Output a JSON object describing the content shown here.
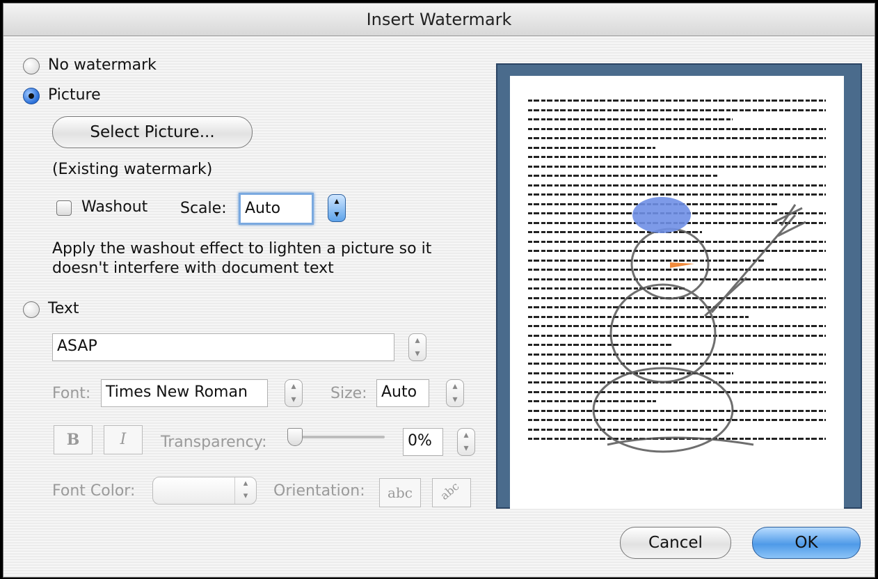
{
  "dialog": {
    "title": "Insert Watermark"
  },
  "options": {
    "no_watermark": "No watermark",
    "picture": "Picture",
    "text": "Text"
  },
  "picture": {
    "select_button": "Select Picture...",
    "existing": "(Existing watermark)",
    "washout_label": "Washout",
    "scale_label": "Scale:",
    "scale_value": "Auto",
    "help_line1": "Apply the washout effect to lighten a picture so it",
    "help_line2": "doesn't interfere with document text"
  },
  "text_options": {
    "text_value": "ASAP",
    "font_label": "Font:",
    "font_value": "Times New Roman",
    "size_label": "Size:",
    "size_value": "Auto",
    "bold": "B",
    "italic": "I",
    "transparency_label": "Transparency:",
    "transparency_value": "0%",
    "font_color_label": "Font Color:",
    "orientation_label": "Orientation:",
    "orientation_horizontal": "abc",
    "orientation_diagonal": "abc"
  },
  "buttons": {
    "cancel": "Cancel",
    "ok": "OK"
  },
  "selected_option": "picture",
  "colors": {
    "accent": "#4f9ae8",
    "preview_border": "#4a6b8c"
  }
}
